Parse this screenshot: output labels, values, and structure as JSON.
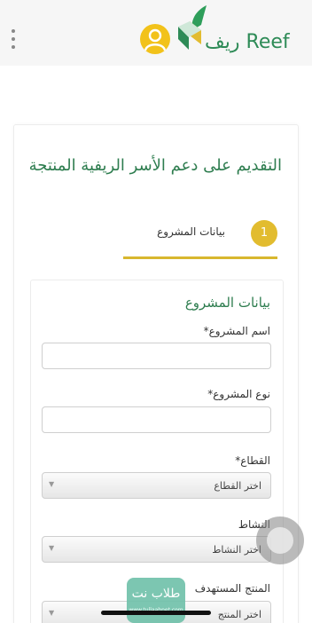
{
  "header": {
    "brand_text": "ريف Reef",
    "icons": [
      "menu-dots-icon",
      "user-avatar-icon",
      "reef-leaf-logo"
    ]
  },
  "page": {
    "title": "التقديم على دعم الأسر الريفية المنتجة"
  },
  "stepper": {
    "step_number": "1",
    "step_label": "بيانات المشروع"
  },
  "form": {
    "section_title": "بيانات المشروع",
    "project_name_label": "اسم المشروع*",
    "project_name_value": "",
    "project_type_label": "نوع المشروع*",
    "project_type_value": "",
    "sector_label": "القطاع*",
    "sector_placeholder": "اختر القطاع",
    "activity_label": "النشاط",
    "activity_placeholder": "اختر النشاط",
    "target_product_label": "المنتج المستهدف",
    "target_product_placeholder": "اختر المنتج"
  },
  "watermark": {
    "text": "طلاب نت",
    "sub": "www.tullaabnet.com"
  },
  "colors": {
    "brand_green": "#2e7d4f",
    "accent_gold": "#e2bc2f",
    "avatar_yellow": "#f2c21a"
  }
}
